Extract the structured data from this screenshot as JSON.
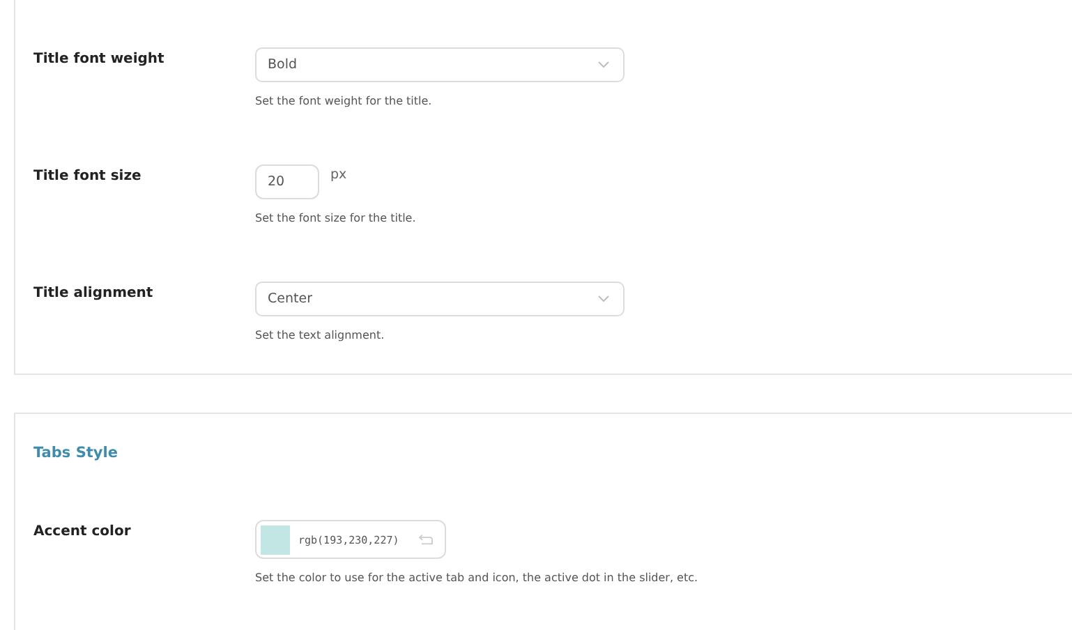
{
  "panels": [
    {
      "fields": [
        {
          "kind": "select",
          "label": "Title font weight",
          "value": "Bold",
          "help": "Set the font weight for the title."
        },
        {
          "kind": "number",
          "label": "Title font size",
          "value": "20",
          "unit": "px",
          "help": "Set the font size for the title."
        },
        {
          "kind": "select",
          "label": "Title alignment",
          "value": "Center",
          "help": "Set the text alignment."
        }
      ]
    },
    {
      "heading": "Tabs Style",
      "fields": [
        {
          "kind": "color",
          "label": "Accent color",
          "value": "rgb(193,230,227)",
          "color": "#c1e6e3",
          "help": "Set the color to use for the active tab and icon, the active dot in the slider, etc."
        }
      ]
    }
  ]
}
